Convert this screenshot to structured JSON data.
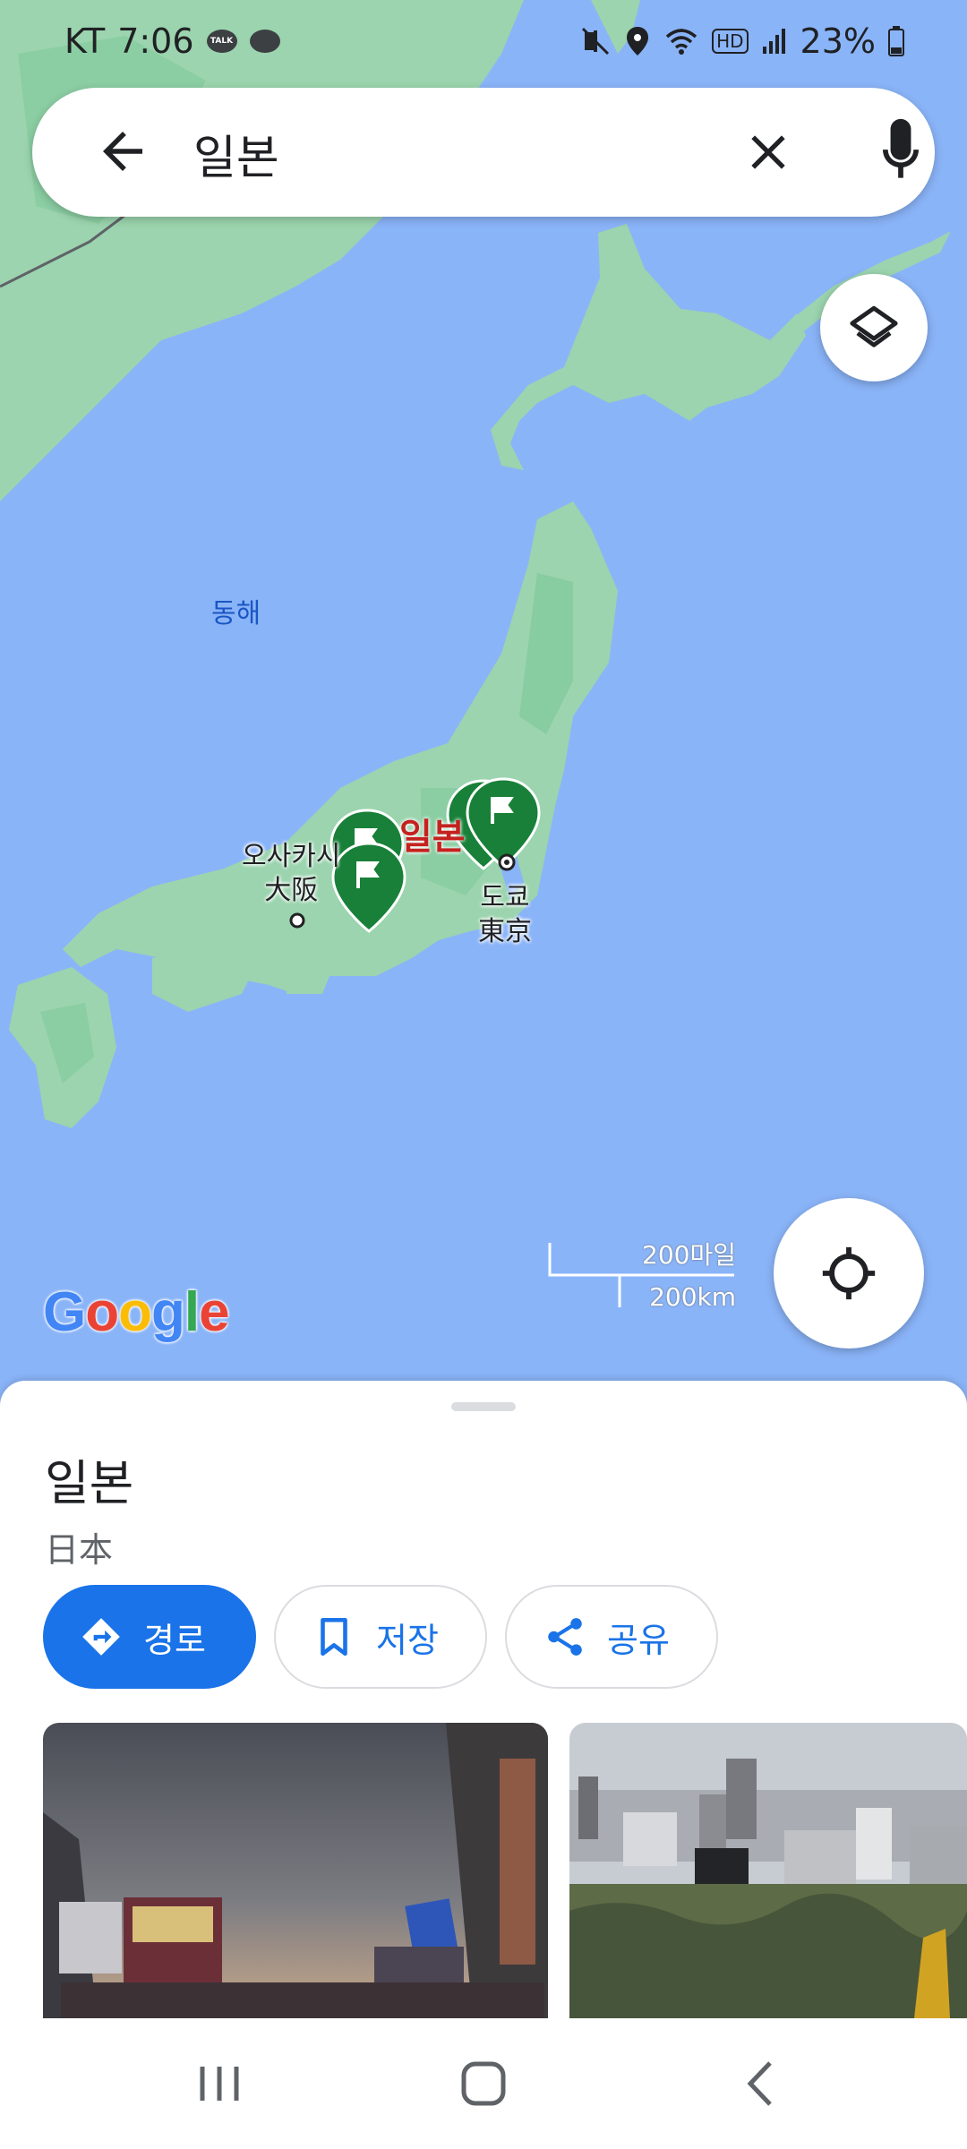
{
  "status_bar": {
    "carrier": "KT",
    "time": "7:06",
    "talk_badge": "TALK",
    "hd_badge": "HD",
    "battery": "23%"
  },
  "search": {
    "query": "일본",
    "back_icon": "arrow-left-icon",
    "clear_icon": "close-icon",
    "mic_icon": "microphone-icon"
  },
  "map": {
    "sea_label": "동해",
    "country_label": "일본",
    "cities": [
      {
        "name_ko": "오사카시",
        "name_ja": "大阪"
      },
      {
        "name_ko": "도쿄",
        "name_ja": "東京"
      }
    ],
    "scale": {
      "imperial": "200마일",
      "metric": "200km"
    },
    "logo": "Google",
    "colors": {
      "water": "#8ab4f8",
      "land": "#9bd4ae",
      "land_dark": "#80c99b",
      "pin": "#188038"
    }
  },
  "sheet": {
    "title": "일본",
    "subtitle": "日本",
    "actions": [
      {
        "label": "경로",
        "icon": "directions-icon"
      },
      {
        "label": "저장",
        "icon": "bookmark-icon"
      },
      {
        "label": "공유",
        "icon": "share-icon"
      }
    ],
    "accent_color": "#1a73e8"
  },
  "nav": {
    "recents_icon": "recent-apps-icon",
    "home_icon": "home-icon",
    "back_icon": "back-chevron-icon"
  }
}
